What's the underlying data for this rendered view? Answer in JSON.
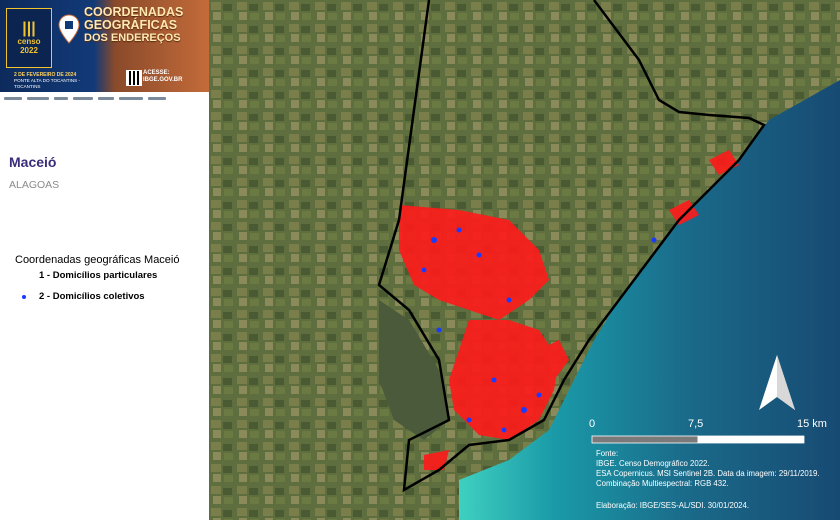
{
  "banner": {
    "logo_line1": "censo",
    "logo_line2": "2022",
    "title_line1": "COORDENADAS",
    "title_line2": "GEOGRÁFICAS",
    "title_line3": "DOS ENDEREÇOS",
    "date": "2 DE FEVEREIRO DE 2024",
    "place": "PONTE ALTA DO TOCANTINS - TOCANTINS",
    "access_label": "ACESSE:",
    "access_url": "IBGE.GOV.BR"
  },
  "location": {
    "city": "Maceió",
    "state": "ALAGOAS"
  },
  "legend": {
    "title": "Coordenadas geográficas Maceió",
    "items": [
      {
        "label": "1 - Domicílios particulares",
        "color": "#ff1a1a"
      },
      {
        "label": "2 - Domicílios coletivos",
        "color": "#1a3aff"
      }
    ]
  },
  "scale_bar": {
    "labels": [
      "0",
      "7,5",
      "15 km"
    ],
    "values_km": [
      0,
      7.5,
      15
    ]
  },
  "north_arrow": {
    "icon": "north-arrow-icon"
  },
  "source": {
    "lines": [
      "Fonte:",
      "IBGE. Censo Demográfico 2022.",
      "ESA Copernicus. MSI Sentinel 2B. Data da imagem: 29/11/2019.",
      "Combinação Multiespectral: RGB 432."
    ],
    "elaboration": "Elaboração: IBGE/SES-AL/SDI. 30/01/2024."
  },
  "colors": {
    "accent": "#3a2d7a",
    "boundary": "#000000",
    "ocean": "#1a9aa8",
    "land": "#5a6a3a"
  }
}
